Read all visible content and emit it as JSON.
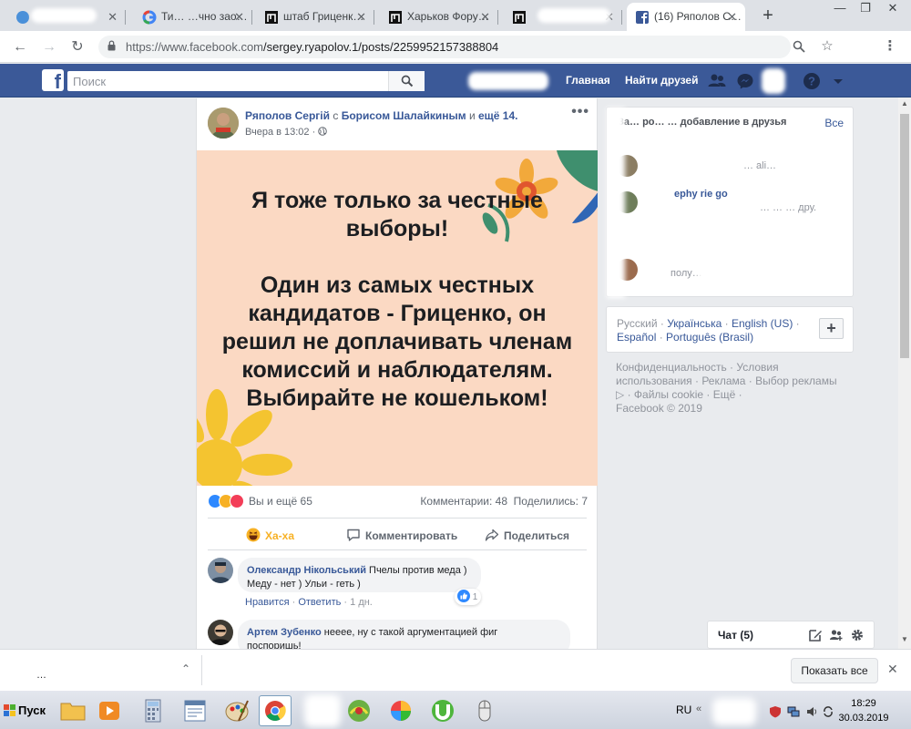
{
  "browser": {
    "tabs": [
      {
        "label": "",
        "favicon": "generic-icon"
      },
      {
        "label": "Ти… …чно зао…",
        "favicon": "google-icon"
      },
      {
        "label": "штаб Гриценк…",
        "favicon": "page-icon"
      },
      {
        "label": "Харьков Фору…",
        "favicon": "page-icon"
      },
      {
        "label": "",
        "favicon": "page-icon"
      },
      {
        "label": "(16) Ряполов С…",
        "favicon": "facebook-icon",
        "active": true
      }
    ],
    "url_host": "https://www.facebook.com",
    "url_path": "/sergey.ryapolov.1/posts/2259952157388804"
  },
  "fb": {
    "search_placeholder": "Поиск",
    "nav": {
      "home": "Главная",
      "find_friends": "Найти друзей"
    }
  },
  "post": {
    "author": "Ряполов Сергій",
    "with_text": "с",
    "tagged": "Борисом Шалайкиным",
    "and_text": "и",
    "more": "ещё 14",
    "time": "Вчера в 13:02 ·",
    "banner_lines": [
      "Я тоже только за честные выборы!",
      "",
      "Один из самых честных кандидатов - Гриценко, он решил не доплачивать членам комиссий и наблюдателям.",
      "Выбирайте не кошельком!"
    ],
    "reactions_text": "Вы и ещё 65",
    "counts": "Комментарии: 48  Поделились: 7",
    "actions": {
      "haha": "Ха-ха",
      "comment": "Комментировать",
      "share": "Поделиться"
    }
  },
  "comments": [
    {
      "author": "Олександр Нікольський",
      "text1": "Пчелы против меда )",
      "text2": "Меду - нет ) Ульи - геть )",
      "like": "Нравится",
      "reply": "Ответить",
      "age": "1 дн.",
      "likes": "1"
    },
    {
      "author": "Артем Зубенко",
      "text1": "неееe, ну с такой аргументацией фиг",
      "text2": "поспоришь!"
    }
  ],
  "sidebar": {
    "friends_title": "За… ро… … добавление в друзья",
    "see_all": "Все",
    "friend_fragments": [
      "ephy rie go",
      "… … … дру.",
      "полу…",
      "… ali…"
    ],
    "languages": [
      "Русский",
      "Українська",
      "English (US)",
      "Español",
      "Português (Brasil)"
    ],
    "footer": "Конфиденциальность · Условия использования · Реклама · Выбор рекламы ▷ · Файлы cookie · Ещё ·",
    "copyright": "Facebook © 2019"
  },
  "chat": {
    "label": "Чат (5)"
  },
  "downloads": {
    "show_all": "Показать все",
    "item": "…"
  },
  "taskbar": {
    "start": "Пуск",
    "lang": "RU",
    "time": "18:29",
    "date": "30.03.2019"
  },
  "colors": {
    "fb_blue": "#3b5998",
    "link": "#385898",
    "banner_bg": "#fbd9c3"
  }
}
